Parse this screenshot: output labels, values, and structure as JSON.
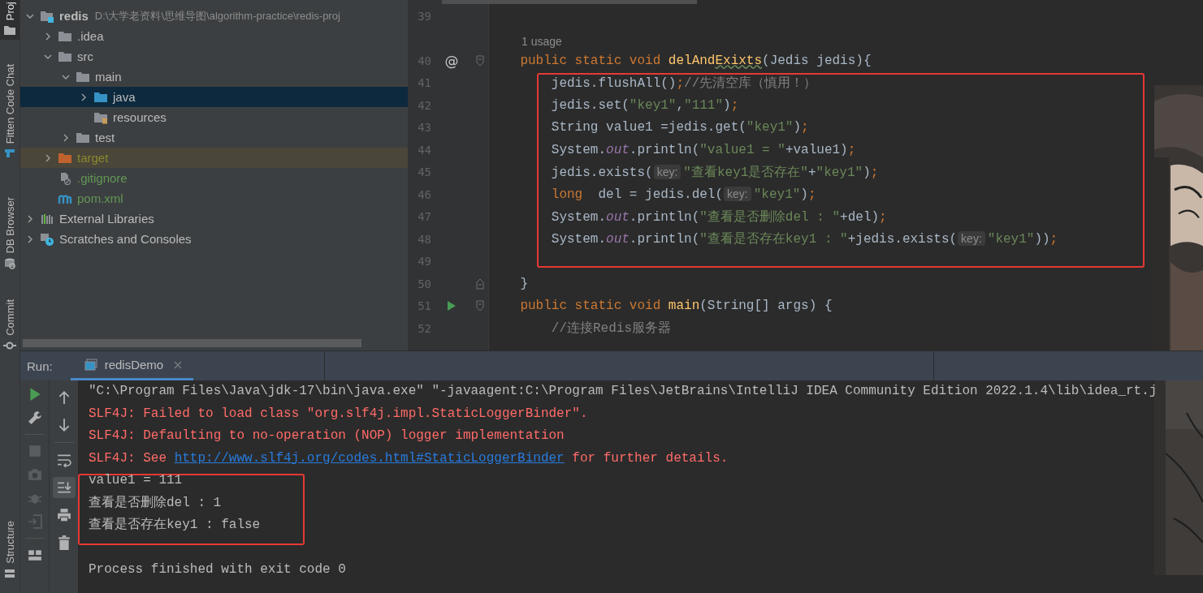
{
  "tool_strip": [
    {
      "label": "Proj",
      "selected": true,
      "kind": "project"
    },
    {
      "label": "Fitten Code Chat",
      "selected": false,
      "kind": "chat"
    },
    {
      "label": "DB Browser",
      "selected": false,
      "kind": "db"
    },
    {
      "label": "Commit",
      "selected": false,
      "kind": "commit"
    },
    {
      "label": "Structure",
      "selected": false,
      "kind": "structure"
    }
  ],
  "project": {
    "tree": [
      {
        "name": "redis",
        "path": "D:\\大学老资料\\思维导图\\algorithm-practice\\redis-proj",
        "kind": "module",
        "expanded": true,
        "selected": false,
        "children": [
          {
            "name": ".idea",
            "kind": "folder",
            "expanded": false,
            "selected": false
          },
          {
            "name": "src",
            "kind": "folder",
            "expanded": true,
            "selected": false,
            "children": [
              {
                "name": "main",
                "kind": "folder",
                "expanded": true,
                "selected": false,
                "children": [
                  {
                    "name": "java",
                    "kind": "source",
                    "expanded": false,
                    "selected": true
                  },
                  {
                    "name": "resources",
                    "kind": "resources",
                    "selected": false
                  }
                ]
              },
              {
                "name": "test",
                "kind": "folder",
                "expanded": false,
                "selected": false
              }
            ]
          },
          {
            "name": "target",
            "kind": "excluded",
            "expanded": false,
            "selected": false,
            "color": "#8a8a2c"
          },
          {
            "name": ".gitignore",
            "kind": "ignore_file",
            "selected": false,
            "color": "#629755"
          },
          {
            "name": "pom.xml",
            "kind": "maven",
            "selected": false,
            "color": "#629755"
          }
        ]
      },
      {
        "name": "External Libraries",
        "kind": "libraries",
        "expanded": false,
        "selected": false
      },
      {
        "name": "Scratches and Consoles",
        "kind": "scratches",
        "expanded": false,
        "selected": false
      }
    ]
  },
  "editor": {
    "sections": [
      {
        "boxed": false,
        "lines": [
          {
            "number": "39"
          },
          {
            "kind": "usage",
            "tokens": [
              {
                "kind": "usage",
                "text": "1 usage"
              }
            ]
          },
          {
            "number": "40",
            "marker": {
              "kind": "override",
              "symbol": "@"
            },
            "fold": {
              "kind": "start"
            },
            "tokens": [
              {
                "kind": "keyword",
                "text": "    public static void "
              },
              {
                "kind": "method",
                "text": "delAnd"
              },
              {
                "kind": "typo",
                "text": "Exixts"
              },
              {
                "kind": "plain",
                "text": "(Jedis jedis){"
              }
            ]
          }
        ]
      },
      {
        "boxed": true,
        "lines": [
          {
            "number": "41",
            "tokens": [
              {
                "kind": "plain",
                "text": "        jedis.flushAll()"
              },
              {
                "kind": "punct",
                "text": ";"
              },
              {
                "kind": "comment",
                "text": "//先清空库（慎用！）"
              }
            ]
          },
          {
            "number": "42",
            "tokens": [
              {
                "kind": "plain",
                "text": "        jedis.set("
              },
              {
                "kind": "string",
                "text": "\"key1\""
              },
              {
                "kind": "plain",
                "text": ","
              },
              {
                "kind": "string",
                "text": "\"111\""
              },
              {
                "kind": "plain",
                "text": ")"
              },
              {
                "kind": "punct",
                "text": ";"
              }
            ]
          },
          {
            "number": "43",
            "tokens": [
              {
                "kind": "plain",
                "text": "        String value1 =jedis.get("
              },
              {
                "kind": "string",
                "text": "\"key1\""
              },
              {
                "kind": "plain",
                "text": ")"
              },
              {
                "kind": "punct",
                "text": ";"
              }
            ]
          },
          {
            "number": "44",
            "tokens": [
              {
                "kind": "plain",
                "text": "        System."
              },
              {
                "kind": "field",
                "text": "out"
              },
              {
                "kind": "plain",
                "text": ".println("
              },
              {
                "kind": "string",
                "text": "\"value1 = \""
              },
              {
                "kind": "plain",
                "text": "+value1)"
              },
              {
                "kind": "punct",
                "text": ";"
              }
            ]
          },
          {
            "number": "45",
            "tokens": [
              {
                "kind": "plain",
                "text": "        jedis.exists("
              },
              {
                "kind": "hint",
                "text": "key:"
              },
              {
                "kind": "string",
                "text": "\"查看key1是否存在\""
              },
              {
                "kind": "plain",
                "text": "+"
              },
              {
                "kind": "string",
                "text": "\"key1\""
              },
              {
                "kind": "plain",
                "text": ")"
              },
              {
                "kind": "punct",
                "text": ";"
              }
            ]
          },
          {
            "number": "46",
            "tokens": [
              {
                "kind": "keyword",
                "text": "        long"
              },
              {
                "kind": "plain",
                "text": "  del = jedis.del("
              },
              {
                "kind": "hint",
                "text": "key:"
              },
              {
                "kind": "string",
                "text": "\"key1\""
              },
              {
                "kind": "plain",
                "text": ")"
              },
              {
                "kind": "punct",
                "text": ";"
              }
            ]
          },
          {
            "number": "47",
            "tokens": [
              {
                "kind": "plain",
                "text": "        System."
              },
              {
                "kind": "field",
                "text": "out"
              },
              {
                "kind": "plain",
                "text": ".println("
              },
              {
                "kind": "string",
                "text": "\"查看是否删除del : \""
              },
              {
                "kind": "plain",
                "text": "+del)"
              },
              {
                "kind": "punct",
                "text": ";"
              }
            ]
          },
          {
            "number": "48",
            "tokens": [
              {
                "kind": "plain",
                "text": "        System."
              },
              {
                "kind": "field",
                "text": "out"
              },
              {
                "kind": "plain",
                "text": ".println("
              },
              {
                "kind": "string",
                "text": "\"查看是否存在key1 : \""
              },
              {
                "kind": "plain",
                "text": "+jedis.exists("
              },
              {
                "kind": "hint",
                "text": "key:"
              },
              {
                "kind": "string",
                "text": "\"key1\""
              },
              {
                "kind": "plain",
                "text": "))"
              },
              {
                "kind": "punct",
                "text": ";"
              }
            ]
          },
          {
            "number": "49"
          }
        ]
      },
      {
        "boxed": false,
        "lines": [
          {
            "number": "50",
            "fold": {
              "kind": "end"
            },
            "tokens": [
              {
                "kind": "plain",
                "text": "    }"
              }
            ]
          },
          {
            "number": "51",
            "marker": {
              "kind": "run"
            },
            "fold": {
              "kind": "start"
            },
            "tokens": [
              {
                "kind": "keyword",
                "text": "    public static void "
              },
              {
                "kind": "method",
                "text": "main"
              },
              {
                "kind": "plain",
                "text": "(String[] args) {"
              }
            ]
          },
          {
            "number": "52",
            "tokens": [
              {
                "kind": "comment",
                "text": "        //连接Redis服务器"
              }
            ]
          }
        ]
      }
    ]
  },
  "run_bar": {
    "label": "Run:",
    "tabs": [
      {
        "label": "redisDemo",
        "selected": true
      }
    ]
  },
  "console": {
    "toolbar_left": [
      {
        "kind": "rerun",
        "disabled": false
      },
      {
        "kind": "settings",
        "disabled": false
      },
      {
        "kind": "stop",
        "disabled": true
      },
      {
        "kind": "screenshot",
        "disabled": true
      },
      {
        "kind": "debug",
        "disabled": true
      },
      {
        "kind": "exit",
        "disabled": true
      },
      {
        "kind": "layout",
        "disabled": false
      }
    ],
    "toolbar_right": [
      {
        "kind": "up",
        "on": false
      },
      {
        "kind": "down",
        "on": false
      },
      {
        "kind": "wrap",
        "on": false
      },
      {
        "kind": "scroll_end",
        "on": true
      },
      {
        "kind": "print",
        "on": false
      },
      {
        "kind": "trash",
        "on": false
      }
    ],
    "sections": [
      {
        "boxed": false,
        "lines": [
          {
            "segments": [
              {
                "kind": "command",
                "text": "\"C:\\Program Files\\Java\\jdk-17\\bin\\java.exe\" \"-javaagent:C:\\Program Files\\JetBrains\\IntelliJ IDEA Community Edition 2022.1.4\\lib\\idea_rt.j"
              }
            ]
          },
          {
            "segments": [
              {
                "kind": "error",
                "text": "SLF4J: Failed to load class \"org.slf4j.impl.StaticLoggerBinder\"."
              }
            ]
          },
          {
            "segments": [
              {
                "kind": "error",
                "text": "SLF4J: Defaulting to no-operation (NOP) logger implementation"
              }
            ]
          },
          {
            "segments": [
              {
                "kind": "error",
                "text": "SLF4J: See "
              },
              {
                "kind": "link",
                "text": "http://www.slf4j.org/codes.html#StaticLoggerBinder"
              },
              {
                "kind": "error",
                "text": " for further details."
              }
            ]
          }
        ]
      },
      {
        "boxed": true,
        "lines": [
          {
            "segments": [
              {
                "kind": "output",
                "text": "value1 = 111"
              }
            ]
          },
          {
            "segments": [
              {
                "kind": "output",
                "text": "查看是否删除del : 1"
              }
            ]
          },
          {
            "segments": [
              {
                "kind": "output",
                "text": "查看是否存在key1 : false"
              }
            ]
          }
        ]
      },
      {
        "boxed": false,
        "lines": [
          {
            "segments": [
              {
                "kind": "output",
                "text": "Process finished with exit code 0"
              }
            ]
          }
        ]
      }
    ]
  }
}
